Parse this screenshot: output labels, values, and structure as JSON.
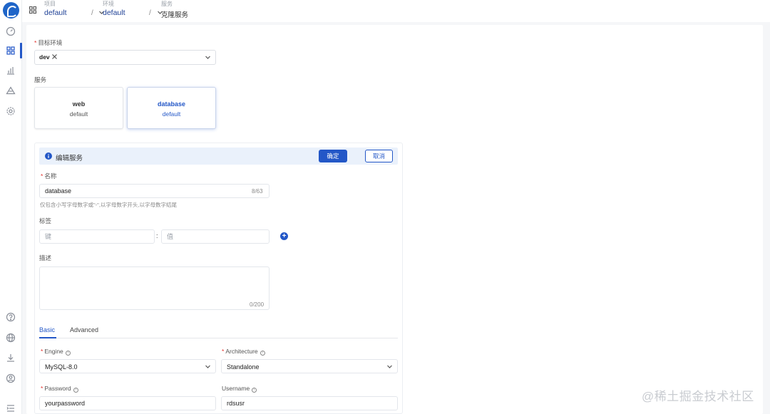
{
  "breadcrumb": {
    "project": {
      "caption": "项目",
      "value": "default"
    },
    "env": {
      "caption": "环境",
      "value": "default"
    },
    "service": {
      "caption": "服务",
      "value": "克隆服务"
    },
    "separator": "/"
  },
  "target_env": {
    "label": "目标环境",
    "tags": [
      "dev"
    ]
  },
  "services": {
    "label": "服务",
    "items": [
      {
        "name": "web",
        "sub": "default",
        "selected": false
      },
      {
        "name": "database",
        "sub": "default",
        "selected": true
      }
    ]
  },
  "edit": {
    "title": "编辑服务",
    "ok_label": "确定",
    "cancel_label": "取消",
    "name_label": "名称",
    "name_value": "database",
    "name_counter": "8/63",
    "name_hint": "仅包含小写字母数字或\"-\",以字母数字开头,以字母数字结尾",
    "tags_label": "标签",
    "key_placeholder": "键",
    "value_placeholder": "值",
    "colon": ":",
    "add_label": "+",
    "desc_label": "描述",
    "desc_counter": "0/200"
  },
  "tabs": [
    {
      "label": "Basic",
      "active": true
    },
    {
      "label": "Advanced",
      "active": false
    }
  ],
  "basic": {
    "engine_label": "Engine",
    "engine_value": "MySQL-8.0",
    "architecture_label": "Architecture",
    "architecture_value": "Standalone",
    "password_label": "Password",
    "password_value": "yourpassword",
    "username_label": "Username",
    "username_value": "rdsusr",
    "info_glyph": "i"
  },
  "watermark": "@稀土掘金技术社区",
  "colors": {
    "primary": "#2357c7",
    "required": "#e3342f",
    "info_bar": "#eaf1fb"
  }
}
